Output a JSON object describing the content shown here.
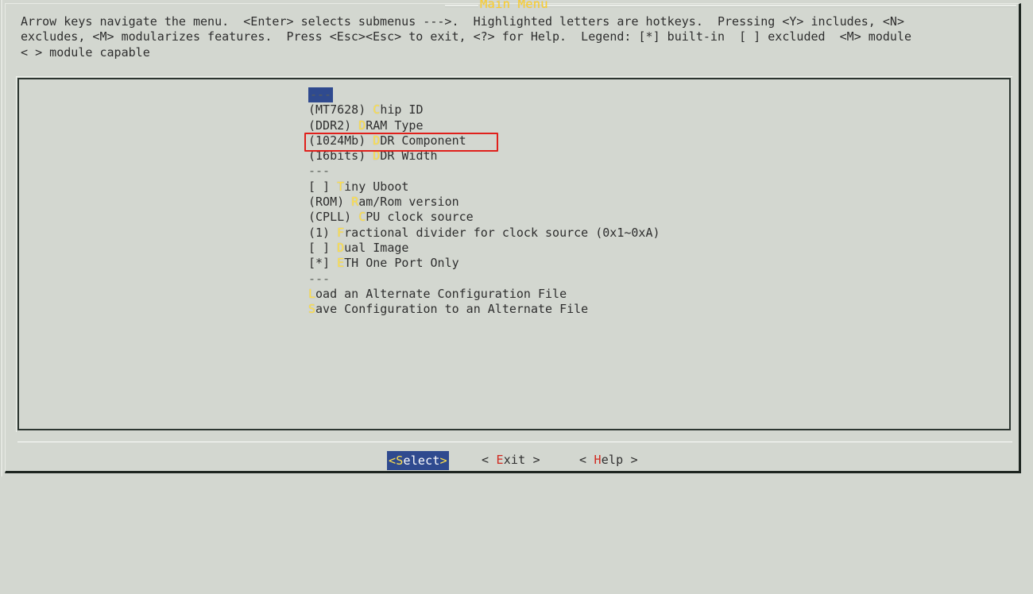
{
  "window": {
    "title": "Main Menu",
    "title_color": "#ffd02a",
    "background_color": "#d3d7d0",
    "frame_color": "#2c3530"
  },
  "help": {
    "text": "Arrow keys navigate the menu.  <Enter> selects submenus --->.  Highlighted letters are hotkeys.  Pressing <Y> includes, <N>\nexcludes, <M> modularizes features.  Press <Esc><Esc> to exit, <?> for Help.  Legend: [*] built-in  [ ] excluded  <M> module\n< > module capable"
  },
  "menu": {
    "selected_index": 0,
    "highlight_color": "#2f4a8f",
    "hotkey_color": "#ffe14d",
    "items": [
      {
        "prefix": "",
        "hot": "",
        "rest": "---",
        "selected": true,
        "type": "separator"
      },
      {
        "prefix": "(MT7628) ",
        "hot": "C",
        "rest": "hip ID",
        "selected": false,
        "type": "choice"
      },
      {
        "prefix": "(DDR2) ",
        "hot": "D",
        "rest": "RAM Type",
        "selected": false,
        "type": "choice"
      },
      {
        "prefix": "(1024Mb) ",
        "hot": "D",
        "rest": "DR Component",
        "selected": false,
        "type": "choice"
      },
      {
        "prefix": "(16bits) ",
        "hot": "D",
        "rest": "DR Width",
        "selected": false,
        "type": "choice"
      },
      {
        "prefix": "",
        "hot": "",
        "rest": "---",
        "selected": false,
        "type": "separator"
      },
      {
        "prefix": "[ ] ",
        "hot": "T",
        "rest": "iny Uboot",
        "selected": false,
        "type": "bool"
      },
      {
        "prefix": "(ROM) ",
        "hot": "R",
        "rest": "am/Rom version",
        "selected": false,
        "type": "choice"
      },
      {
        "prefix": "(CPLL) ",
        "hot": "C",
        "rest": "PU clock source",
        "selected": false,
        "type": "choice"
      },
      {
        "prefix": "(1) ",
        "hot": "F",
        "rest": "ractional divider for clock source (0x1~0xA)",
        "selected": false,
        "type": "choice"
      },
      {
        "prefix": "[ ] ",
        "hot": "D",
        "rest": "ual Image",
        "selected": false,
        "type": "bool"
      },
      {
        "prefix": "[*] ",
        "hot": "E",
        "rest": "TH One Port Only",
        "selected": false,
        "type": "bool"
      },
      {
        "prefix": "",
        "hot": "",
        "rest": "---",
        "selected": false,
        "type": "separator"
      },
      {
        "prefix": "",
        "hot": "L",
        "rest": "oad an Alternate Configuration File",
        "selected": false,
        "type": "action"
      },
      {
        "prefix": "",
        "hot": "S",
        "rest": "ave Configuration to an Alternate File",
        "selected": false,
        "type": "action"
      }
    ]
  },
  "annotation": {
    "target_row_index": 3,
    "box_color": "#e0201b"
  },
  "buttons": {
    "select": {
      "open": "<",
      "hot": "S",
      "rest": "elect",
      "close": ">",
      "active": true
    },
    "exit": {
      "open": "< ",
      "hot": "E",
      "rest": "xit",
      "close": " >",
      "active": false
    },
    "help": {
      "open": "< ",
      "hot": "H",
      "rest": "elp",
      "close": " >",
      "active": false
    }
  }
}
